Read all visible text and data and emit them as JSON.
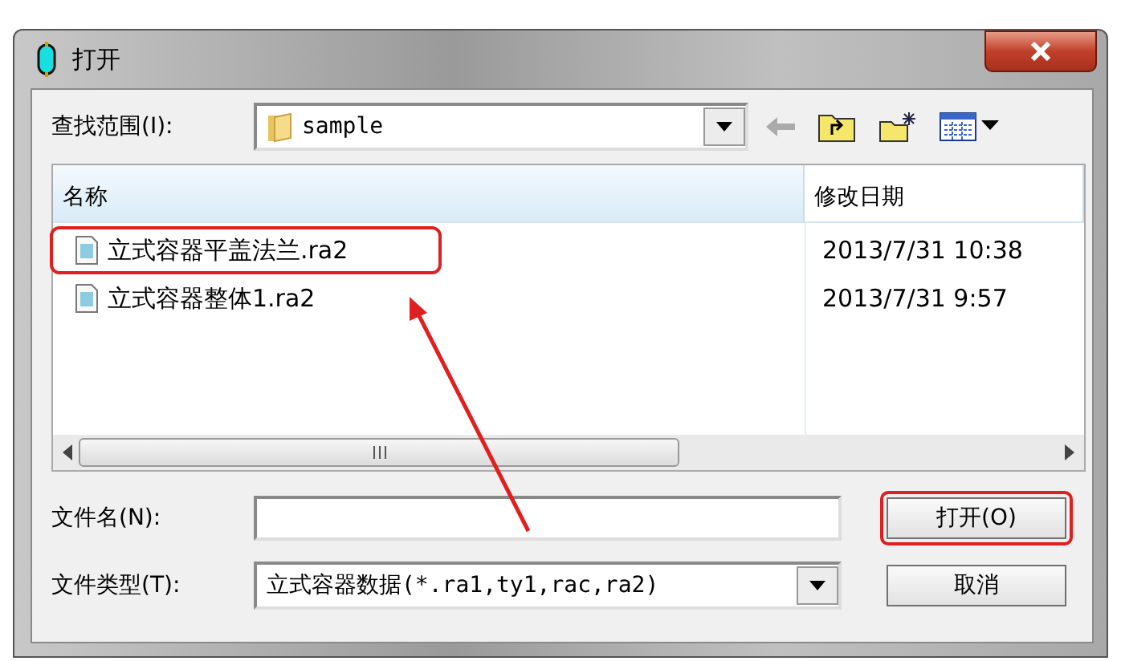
{
  "window": {
    "title": "打开"
  },
  "look_in": {
    "label": "查找范围(I):",
    "value": "sample"
  },
  "file_list": {
    "columns": [
      "名称",
      "修改日期"
    ],
    "rows": [
      {
        "name": "立式容器平盖法兰.ra2",
        "modified": "2013/7/31 10:38",
        "highlighted": true
      },
      {
        "name": "立式容器整体1.ra2",
        "modified": "2013/7/31 9:57",
        "highlighted": false
      }
    ]
  },
  "file_name": {
    "label": "文件名(N):"
  },
  "file_type": {
    "label": "文件类型(T):",
    "value": "立式容器数据(*.ra1,ty1,rac,ra2)"
  },
  "buttons": [
    {
      "label": "打开(O)",
      "highlighted": true
    },
    {
      "label": "取消",
      "highlighted": false
    }
  ],
  "annotation_arrow": true
}
